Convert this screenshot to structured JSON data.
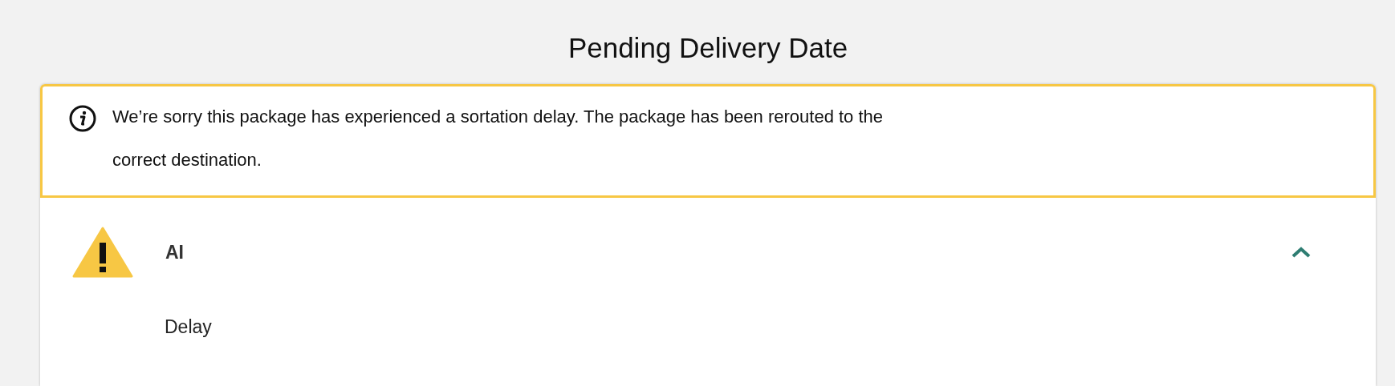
{
  "title": "Pending Delivery Date",
  "notice": {
    "text": "We’re sorry this package has experienced a sortation delay. The package has been rerouted to the correct destination."
  },
  "section": {
    "label": "AI",
    "expanded": true,
    "detail": "Delay"
  }
}
